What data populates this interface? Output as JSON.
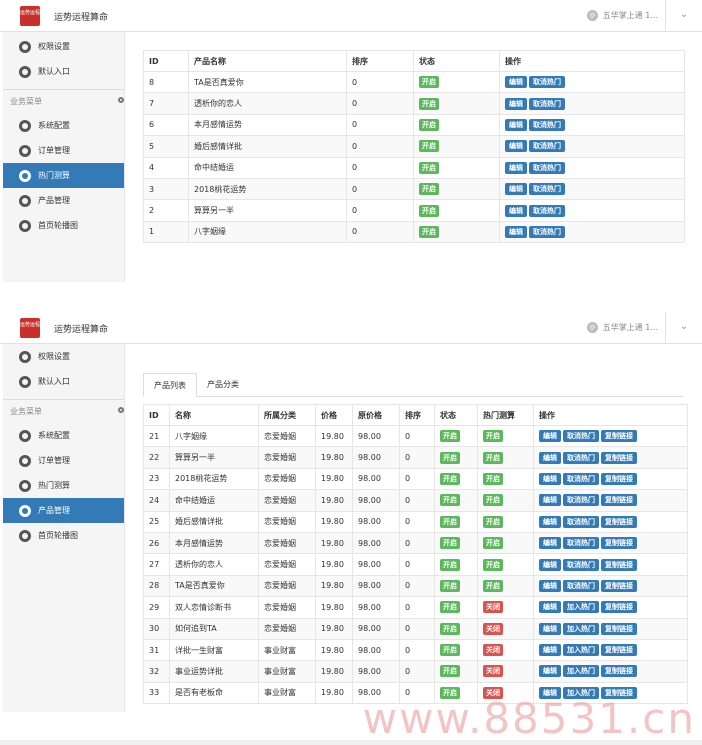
{
  "app": {
    "logo_text": "运势运程",
    "title": "运势运程算命",
    "user_label": "五华掌上通 1...",
    "user_initial": "@"
  },
  "sidebar": {
    "top_items": [
      {
        "label": "权限设置"
      },
      {
        "label": "默认入口"
      }
    ],
    "group_label": "业务菜单",
    "items": [
      {
        "label": "系统配置"
      },
      {
        "label": "订单管理"
      },
      {
        "label": "热门测算"
      },
      {
        "label": "产品管理"
      },
      {
        "label": "首页轮播图"
      }
    ]
  },
  "hot_table": {
    "columns": [
      "ID",
      "产品名称",
      "排序",
      "状态",
      "操作"
    ],
    "rows": [
      {
        "id": "8",
        "name": "TA是否真爱你",
        "sort": "0",
        "status": "开启"
      },
      {
        "id": "7",
        "name": "透析你的恋人",
        "sort": "0",
        "status": "开启"
      },
      {
        "id": "6",
        "name": "本月感情运势",
        "sort": "0",
        "status": "开启"
      },
      {
        "id": "5",
        "name": "婚后感情详批",
        "sort": "0",
        "status": "开启"
      },
      {
        "id": "4",
        "name": "命中结婚运",
        "sort": "0",
        "status": "开启"
      },
      {
        "id": "3",
        "name": "2018桃花运势",
        "sort": "0",
        "status": "开启"
      },
      {
        "id": "2",
        "name": "算算另一半",
        "sort": "0",
        "status": "开启"
      },
      {
        "id": "1",
        "name": "八字姻缘",
        "sort": "0",
        "status": "开启"
      }
    ],
    "edit_label": "编辑",
    "cancel_hot_label": "取消热门"
  },
  "product_tabs": [
    "产品列表",
    "产品分类"
  ],
  "product_table": {
    "columns": [
      "ID",
      "名称",
      "所属分类",
      "价格",
      "原价格",
      "排序",
      "状态",
      "热门测算",
      "操作"
    ],
    "rows": [
      {
        "id": "21",
        "name": "八字姻缘",
        "cat": "恋爱婚姻",
        "price": "19.80",
        "orig": "98.00",
        "sort": "0",
        "status": "开启",
        "hot": "开启",
        "hot_on": true,
        "action": "取消热门"
      },
      {
        "id": "22",
        "name": "算算另一半",
        "cat": "恋爱婚姻",
        "price": "19.80",
        "orig": "98.00",
        "sort": "0",
        "status": "开启",
        "hot": "开启",
        "hot_on": true,
        "action": "取消热门"
      },
      {
        "id": "23",
        "name": "2018桃花运势",
        "cat": "恋爱婚姻",
        "price": "19.80",
        "orig": "98.00",
        "sort": "0",
        "status": "开启",
        "hot": "开启",
        "hot_on": true,
        "action": "取消热门"
      },
      {
        "id": "24",
        "name": "命中结婚运",
        "cat": "恋爱婚姻",
        "price": "19.80",
        "orig": "98.00",
        "sort": "0",
        "status": "开启",
        "hot": "开启",
        "hot_on": true,
        "action": "取消热门"
      },
      {
        "id": "25",
        "name": "婚后感情详批",
        "cat": "恋爱婚姻",
        "price": "19.80",
        "orig": "98.00",
        "sort": "0",
        "status": "开启",
        "hot": "开启",
        "hot_on": true,
        "action": "取消热门"
      },
      {
        "id": "26",
        "name": "本月感情运势",
        "cat": "恋爱婚姻",
        "price": "19.80",
        "orig": "98.00",
        "sort": "0",
        "status": "开启",
        "hot": "开启",
        "hot_on": true,
        "action": "取消热门"
      },
      {
        "id": "27",
        "name": "透析你的恋人",
        "cat": "恋爱婚姻",
        "price": "19.80",
        "orig": "98.00",
        "sort": "0",
        "status": "开启",
        "hot": "开启",
        "hot_on": true,
        "action": "取消热门"
      },
      {
        "id": "28",
        "name": "TA是否真爱你",
        "cat": "恋爱婚姻",
        "price": "19.80",
        "orig": "98.00",
        "sort": "0",
        "status": "开启",
        "hot": "开启",
        "hot_on": true,
        "action": "取消热门"
      },
      {
        "id": "29",
        "name": "双人恋情诊断书",
        "cat": "恋爱婚姻",
        "price": "19.80",
        "orig": "98.00",
        "sort": "0",
        "status": "开启",
        "hot": "关闭",
        "hot_on": false,
        "action": "加入热门"
      },
      {
        "id": "30",
        "name": "如何追到TA",
        "cat": "恋爱婚姻",
        "price": "19.80",
        "orig": "98.00",
        "sort": "0",
        "status": "开启",
        "hot": "关闭",
        "hot_on": false,
        "action": "加入热门"
      },
      {
        "id": "31",
        "name": "详批一生财富",
        "cat": "事业财富",
        "price": "19.80",
        "orig": "98.00",
        "sort": "0",
        "status": "开启",
        "hot": "关闭",
        "hot_on": false,
        "action": "加入热门"
      },
      {
        "id": "32",
        "name": "事业运势详批",
        "cat": "事业财富",
        "price": "19.80",
        "orig": "98.00",
        "sort": "0",
        "status": "开启",
        "hot": "关闭",
        "hot_on": false,
        "action": "加入热门"
      },
      {
        "id": "33",
        "name": "是否有老板命",
        "cat": "事业财富",
        "price": "19.80",
        "orig": "98.00",
        "sort": "0",
        "status": "开启",
        "hot": "关闭",
        "hot_on": false,
        "action": "加入热门"
      }
    ],
    "edit_label": "编辑",
    "copy_link_label": "复制链接"
  },
  "watermark": "www.88531.cn",
  "colors": {
    "primary": "#337ab7",
    "success": "#5cb85c",
    "danger": "#d9534f",
    "logo": "#c9302c"
  }
}
